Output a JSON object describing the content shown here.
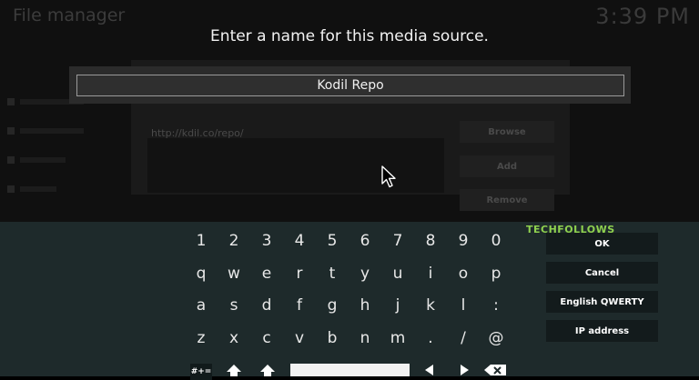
{
  "background": {
    "title": "File manager",
    "clock": "3:39 PM",
    "url": "http://kdil.co/repo/",
    "buttons": [
      "Browse",
      "Add",
      "Remove"
    ]
  },
  "dialog": {
    "prompt": "Enter a name for this media source.",
    "input_value": "Kodil Repo"
  },
  "keyboard": {
    "rows": [
      [
        "1",
        "2",
        "3",
        "4",
        "5",
        "6",
        "7",
        "8",
        "9",
        "0"
      ],
      [
        "q",
        "w",
        "e",
        "r",
        "t",
        "y",
        "u",
        "i",
        "o",
        "p"
      ],
      [
        "a",
        "s",
        "d",
        "f",
        "g",
        "h",
        "j",
        "k",
        "l",
        ":"
      ],
      [
        "z",
        "x",
        "c",
        "v",
        "b",
        "n",
        "m",
        ".",
        "/",
        "@"
      ]
    ],
    "symbols_key": "#+=",
    "side_buttons": [
      "OK",
      "Cancel",
      "English QWERTY",
      "IP address"
    ]
  },
  "watermark": "TECHFOLLOWS",
  "icons": {
    "shift": "shift-icon",
    "caps": "caps-icon",
    "left": "arrow-left-icon",
    "right": "arrow-right-icon",
    "backspace": "backspace-icon",
    "cursor": "mouse-pointer-icon"
  }
}
